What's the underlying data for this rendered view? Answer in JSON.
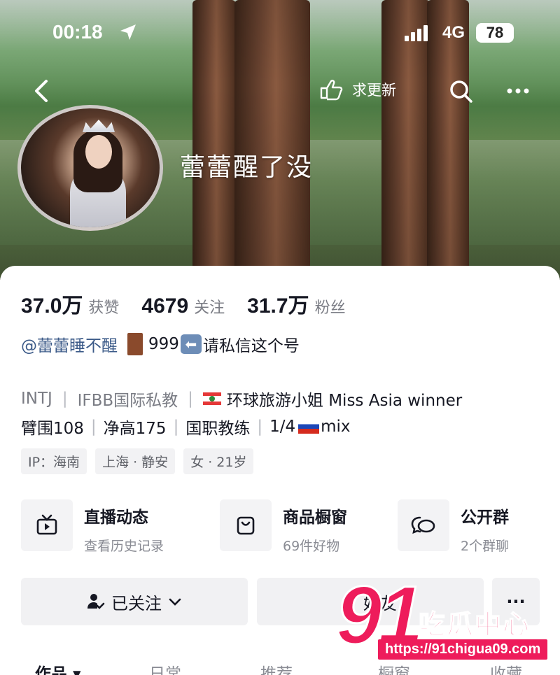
{
  "status_bar": {
    "time": "00:18",
    "network": "4G",
    "battery": "78"
  },
  "nav": {
    "update_label": "求更新"
  },
  "profile": {
    "nickname": "蕾蕾醒了没"
  },
  "stats": [
    {
      "num": "37.0万",
      "label": "获赞"
    },
    {
      "num": "4679",
      "label": "关注"
    },
    {
      "num": "31.7万",
      "label": "粉丝"
    }
  ],
  "bind_line": {
    "handle": "@蕾蕾睡不醒",
    "num": "999",
    "text": "请私信这个号"
  },
  "bio": {
    "line1_a": "INTJ",
    "line1_b": "IFBB国际私教",
    "line1_c": "环球旅游小姐 Miss Asia winner",
    "line2_a": "臂围108",
    "line2_b": "净高175",
    "line2_c": "国职教练",
    "line2_d": "1/4",
    "line2_e": "mix"
  },
  "tags": [
    "IP：海南",
    "上海 · 静安",
    "女 · 21岁"
  ],
  "features": [
    {
      "title": "直播动态",
      "sub": "查看历史记录",
      "icon": "tv-icon"
    },
    {
      "title": "商品橱窗",
      "sub": "69件好物",
      "icon": "bag-icon"
    },
    {
      "title": "公开群",
      "sub": "2个群聊",
      "icon": "chat-icon"
    }
  ],
  "buttons": {
    "follow": "已关注",
    "friend": "好友",
    "more": "···"
  },
  "tabs": [
    "作品",
    "日常",
    "推荐",
    "橱窗",
    "收藏"
  ],
  "watermark": {
    "logo": "91",
    "text": "吃瓜中心",
    "url": "https://91chigua09.com"
  },
  "colors": {
    "accent": "#ee1c5b",
    "link": "#3b5a88"
  }
}
